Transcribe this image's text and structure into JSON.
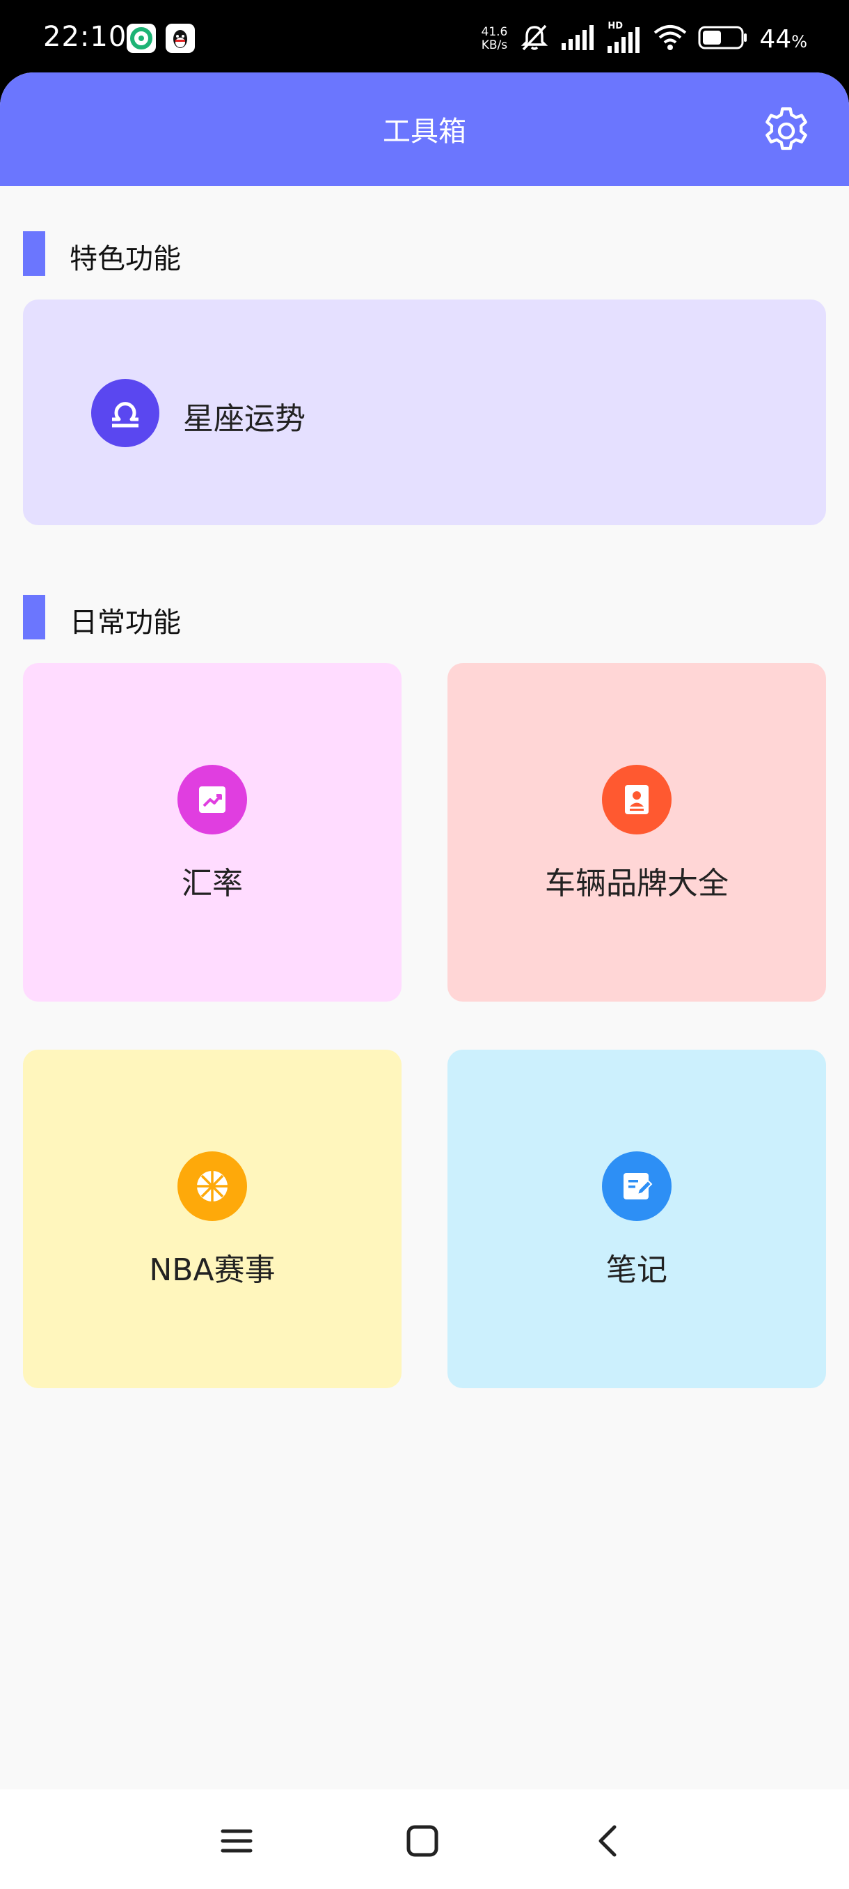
{
  "status_bar": {
    "time": "22:10",
    "speed_value": "41.6",
    "speed_unit": "KB/s",
    "signal_badge": "HD",
    "battery_percent": "44",
    "percent_sign": "%",
    "icons": [
      "app-notification-icon",
      "qq-icon",
      "mute-icon",
      "signal-icon",
      "signal-hd-icon",
      "wifi-icon",
      "battery-icon"
    ]
  },
  "header": {
    "title": "工具箱",
    "settings_icon": "gear-icon"
  },
  "featured": {
    "section_title": "特色功能",
    "items": [
      {
        "label": "星座运势",
        "icon": "libra-icon",
        "color": "#5a47f0",
        "bg": "#e5e0ff"
      }
    ]
  },
  "daily": {
    "section_title": "日常功能",
    "items": [
      {
        "label": "汇率",
        "icon": "trend-chart-icon",
        "color": "#e03ee0",
        "bg": "#ffdcff"
      },
      {
        "label": "车辆品牌大全",
        "icon": "contact-book-icon",
        "color": "#ff5930",
        "bg": "#ffd6d6"
      },
      {
        "label": "NBA赛事",
        "icon": "basketball-icon",
        "color": "#fea90a",
        "bg": "#fff6bd"
      },
      {
        "label": "笔记",
        "icon": "note-edit-icon",
        "color": "#2d8ff5",
        "bg": "#ccf0fd"
      }
    ]
  },
  "accent_color": "#6b76fe",
  "nav_bar": {
    "icons": [
      "menu-icon",
      "home-icon",
      "back-icon"
    ]
  }
}
